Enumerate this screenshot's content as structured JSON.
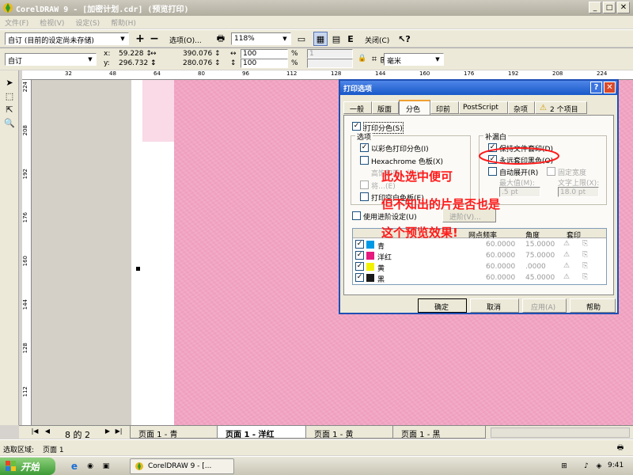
{
  "window": {
    "title": "CorelDRAW 9 - [加密计划.cdr] (预览打印)"
  },
  "menu": [
    "文件(F)",
    "检视(V)",
    "设定(S)",
    "帮助(H)"
  ],
  "toolbar1": {
    "preset_value": "自订 (目前的设定尚未存储)",
    "options_label": "选项(O)...",
    "zoom_value": "118%",
    "close_label": "关闭(C)"
  },
  "toolbar2": {
    "style_value": "自订",
    "x_label": "x:",
    "x_value": "59.228 ↕",
    "y_label": "y:",
    "y_value": "296.732 ↕",
    "w_value": "390.076 ↕",
    "h_value": "280.076 ↕",
    "sx_value": "100",
    "sy_value": "100",
    "pct": "%",
    "tile_value": "1",
    "unit_value": "毫米"
  },
  "ruler": {
    "h_ticks": [
      "32",
      "48",
      "64",
      "80",
      "96",
      "112",
      "128",
      "144",
      "160",
      "176",
      "192",
      "208",
      "224"
    ],
    "v_ticks": [
      "224",
      "208",
      "192",
      "176",
      "160",
      "144",
      "128",
      "112"
    ]
  },
  "page_tabs": {
    "counter": "8 的 2",
    "tabs": [
      "页面 1 - 青",
      "页面 1 - 洋红",
      "页面 1 - 黄",
      "页面 1 - 黑"
    ]
  },
  "statusbar": {
    "label": "选取区域:",
    "value": "页面 1"
  },
  "taskbar": {
    "start": "开始",
    "task": "CorelDRAW 9 - [...",
    "time": "9:41"
  },
  "dialog": {
    "title": "打印选项",
    "tabs": [
      "一般",
      "版面",
      "分色",
      "印前",
      "PostScript",
      "杂项",
      "2 个项目"
    ],
    "print_sep_label": "打印分色(S)",
    "options_group": "选项",
    "opt_color": "以彩色打印分色(I)",
    "opt_hexa": "Hexachrome 色板(X)",
    "opt_hidden1": "高饱和蓝、绿(H)",
    "opt_hidden2": "将…(E)",
    "opt_blank": "打印空白色板(E)",
    "trap_group": "补漏白",
    "trap_keep": "保持文件套印(D)",
    "trap_black": "永远套印黑色(O)",
    "trap_auto": "自动展开(R)",
    "trap_fixed": "固定宽度",
    "trap_max_label": "最大值(M):",
    "trap_max_val": ".5 pt",
    "trap_text_label": "文字上限(X):",
    "trap_text_val": "18.0 pt",
    "adv_label": "使用进阶设定(U)",
    "adv_btn": "进阶(V)...",
    "table_headers": [
      "",
      "网点频率",
      "角度",
      "套印"
    ],
    "inks": [
      {
        "name": "青",
        "color": "#0099e6",
        "freq": "60.0000",
        "angle": "15.0000"
      },
      {
        "name": "洋红",
        "color": "#e6197f",
        "freq": "60.0000",
        "angle": "75.0000"
      },
      {
        "name": "黄",
        "color": "#f2f200",
        "freq": "60.0000",
        "angle": ".0000"
      },
      {
        "name": "黑",
        "color": "#1a1a1a",
        "freq": "60.0000",
        "angle": "45.0000"
      }
    ],
    "ok": "确定",
    "cancel": "取消",
    "apply": "应用(A)",
    "help": "帮助"
  },
  "annotation": {
    "line1": "此处选中便可",
    "line2": "但不知出的片是否也是",
    "line3": "这个预览效果!"
  },
  "colors": {
    "titlebar": "#b9b5aa",
    "pink": "#f1a4c2",
    "annotation": "#ff1a1a",
    "dialog_title": "#1858c8"
  }
}
